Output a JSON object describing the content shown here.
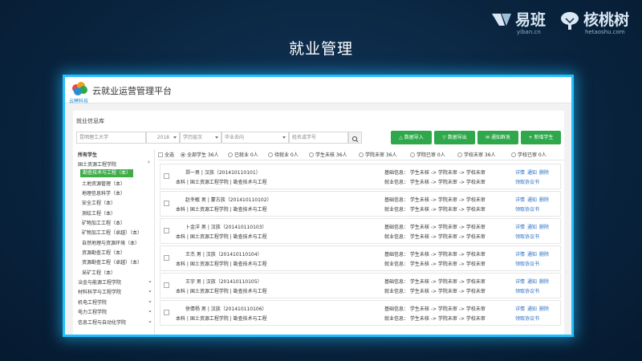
{
  "slide": {
    "title": "就业管理"
  },
  "brands": {
    "yiban": {
      "name": "易班",
      "domain": "yiban.cn"
    },
    "hetao": {
      "name": "核桃树",
      "domain": "hetaoshu.com"
    }
  },
  "app": {
    "logo_text": "云聘科技",
    "title": "云就业运营管理平台"
  },
  "panel": {
    "title": "就业信息库"
  },
  "filters": {
    "school": "昆明理工大学",
    "year": "2018",
    "degree": "学历层次",
    "destination": "毕业去向",
    "search_placeholder": "姓名或学号"
  },
  "buttons": {
    "import": "数据导入",
    "export": "数据导出",
    "notify": "通知群发",
    "add": "新增学生",
    "import_icon": "user-import-icon",
    "export_icon": "user-export-icon",
    "notify_icon": "notify-icon",
    "add_icon": "plus-icon"
  },
  "tree": {
    "root": "所有学生",
    "colleges": [
      {
        "label": "国土资源工程学院",
        "expanded": true
      },
      {
        "label": "冶金与能源工程学院",
        "expanded": false
      },
      {
        "label": "材料科学与工程学院",
        "expanded": false
      },
      {
        "label": "机电工程学院",
        "expanded": false
      },
      {
        "label": "电力工程学院",
        "expanded": false
      },
      {
        "label": "信息工程与自动化学院",
        "expanded": false
      }
    ],
    "majors": [
      "勘查技术与工程（本）",
      "土地资源管理（本）",
      "地理信息科学（本）",
      "安全工程（本）",
      "测绘工程（本）",
      "矿物加工工程（本）",
      "矿物加工工程（卓越）（本）",
      "自然地理与资源环境（本）",
      "资源勘查工程（本）",
      "资源勘查工程（卓越）（本）",
      "采矿工程（本）"
    ],
    "selected_major": "勘查技术与工程（本）"
  },
  "status_filters": {
    "select_all": "全选",
    "options": [
      "全部学生 36人",
      "已就业 0人",
      "待就业 0人",
      "学生未核 36人",
      "学院未审 36人",
      "学院已审 0人",
      "学校未审 36人",
      "学校已审 0人"
    ],
    "selected": "全部学生 36人"
  },
  "students": [
    {
      "name_line": "郑一男 | 汉族（201410110101）",
      "info": "本科 | 国土资源工程学院 | 勘查技术与工程",
      "basic": "基础信息： 学生未核 -> 学院未审 -> 学校未审",
      "employ": "就业信息： 学生未核 -> 学院未审 -> 学校未审"
    },
    {
      "name_line": "赵冬敏 男 | 蒙古族（201410110102）",
      "info": "本科 | 国土资源工程学院 | 勘查技术与工程",
      "basic": "基础信息： 学生未核 -> 学院未审 -> 学校未审",
      "employ": "就业信息： 学生未核 -> 学院未审 -> 学校未审"
    },
    {
      "name_line": "卜金洋 男 | 汉族（201410110103）",
      "info": "本科 | 国土资源工程学院 | 勘查技术与工程",
      "basic": "基础信息： 学生未核 -> 学院未审 -> 学校未审",
      "employ": "就业信息： 学生未核 -> 学院未审 -> 学校未审"
    },
    {
      "name_line": "王杰 男 | 汉族（201410110104）",
      "info": "本科 | 国土资源工程学院 | 勘查技术与工程",
      "basic": "基础信息： 学生未核 -> 学院未审 -> 学校未审",
      "employ": "就业信息： 学生未核 -> 学院未审 -> 学校未审"
    },
    {
      "name_line": "王宇 男 | 汉族（201410110105）",
      "info": "本科 | 国土资源工程学院 | 勘查技术与工程",
      "basic": "基础信息： 学生未核 -> 学院未审 -> 学校未审",
      "employ": "就业信息： 学生未核 -> 学院未审 -> 学校未审"
    },
    {
      "name_line": "徐倩杨 男 | 汉族（201410110106）",
      "info": "本科 | 国土资源工程学院 | 勘查技术与工程",
      "basic": "基础信息： 学生未核 -> 学院未审 -> 学校未审",
      "employ": "就业信息： 学生未核 -> 学院未审 -> 学校未审"
    }
  ],
  "row_actions": {
    "detail": "详情",
    "notify": "通知",
    "delete": "删除",
    "agreement": "领取协议书"
  },
  "colors": {
    "accent_green": "#2ea84a",
    "frame_glow": "#20c0ff",
    "link_blue": "#2b6fc2",
    "bg_navy": "#0a2540"
  }
}
